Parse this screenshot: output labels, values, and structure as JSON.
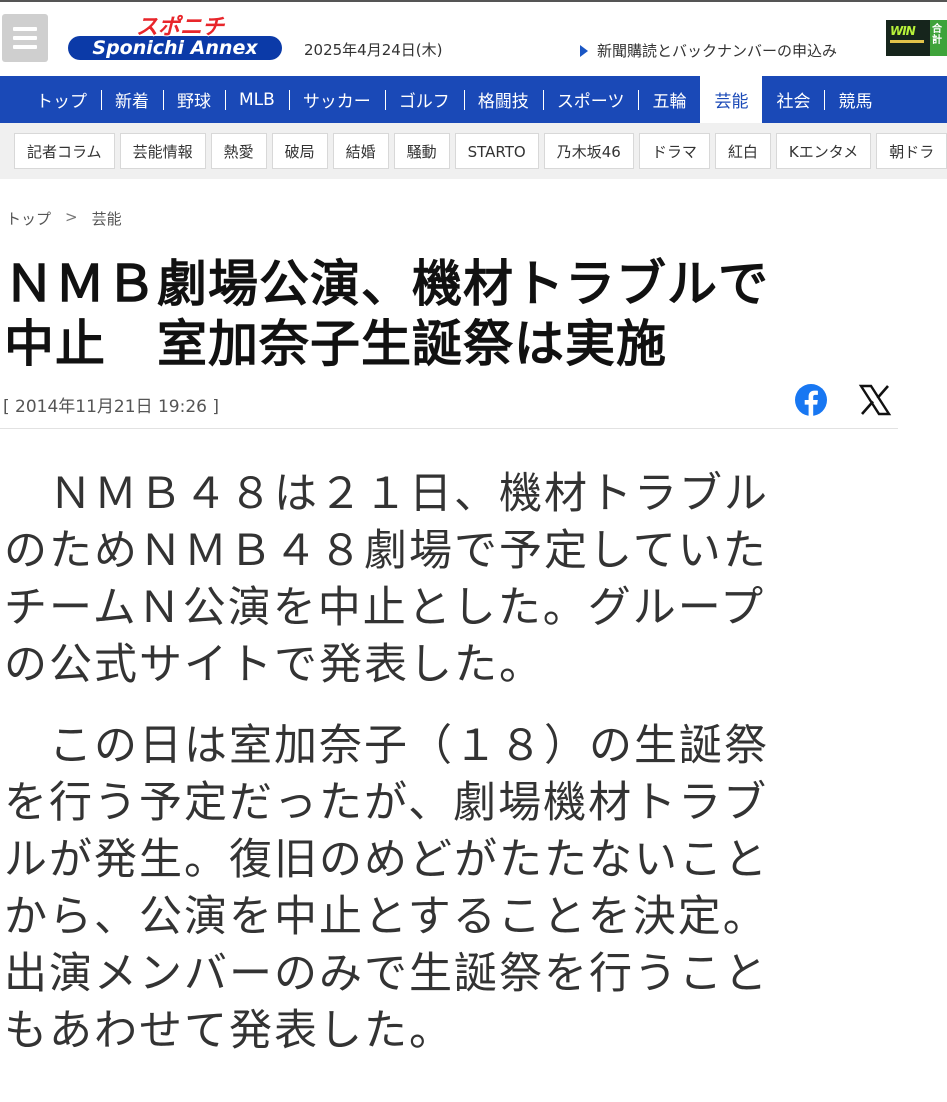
{
  "header": {
    "logo_top": "スポニチ",
    "logo_bottom": "Sponichi Annex",
    "date": "2025年4月24日(木)",
    "subscribe_link": "新聞購読とバックナンバーの申込み",
    "ad_text": "WIN",
    "ad_side": "合計"
  },
  "nav": {
    "items": [
      {
        "label": "トップ"
      },
      {
        "label": "新着"
      },
      {
        "label": "野球"
      },
      {
        "label": "MLB"
      },
      {
        "label": "サッカー"
      },
      {
        "label": "ゴルフ"
      },
      {
        "label": "格闘技"
      },
      {
        "label": "スポーツ"
      },
      {
        "label": "五輪"
      },
      {
        "label": "芸能"
      },
      {
        "label": "社会"
      },
      {
        "label": "競馬"
      }
    ],
    "active": "芸能"
  },
  "subnav": {
    "items": [
      {
        "label": "記者コラム"
      },
      {
        "label": "芸能情報"
      },
      {
        "label": "熱愛"
      },
      {
        "label": "破局"
      },
      {
        "label": "結婚"
      },
      {
        "label": "騒動"
      },
      {
        "label": "STARTO"
      },
      {
        "label": "乃木坂46"
      },
      {
        "label": "ドラマ"
      },
      {
        "label": "紅白"
      },
      {
        "label": "Kエンタメ"
      },
      {
        "label": "朝ドラ"
      }
    ]
  },
  "breadcrumb": {
    "home": "トップ",
    "separator": ">",
    "current": "芸能"
  },
  "article": {
    "headline_lines": [
      "ＮＭＢ劇場公演、機材トラブルで",
      "中止　室加奈子生誕祭は実施"
    ],
    "timestamp": "[ 2014年11月21日 19:26 ]",
    "paragraphs": [
      {
        "lines": [
          "　ＮＭＢ４８は２１日、機材トラブル",
          "のためＮＭＢ４８劇場で予定していた",
          "チームＮ公演を中止とした。グループ",
          "の公式サイトで発表した。"
        ]
      },
      {
        "lines": [
          "　この日は室加奈子（１８）の生誕祭",
          "を行う予定だったが、劇場機材トラブ",
          "ルが発生。復旧のめどがたたないこと",
          "から、公演を中止とすることを決定。",
          "出演メンバーのみで生誕祭を行うこと",
          "もあわせて発表した。"
        ]
      }
    ]
  },
  "share": {
    "facebook_icon": "facebook-icon",
    "x_icon": "x-icon"
  },
  "colors": {
    "nav_bg": "#1a49b7",
    "subnav_bg": "#f0f0f0",
    "facebook_blue": "#1877f2",
    "link_triangle": "#1a56c4"
  }
}
